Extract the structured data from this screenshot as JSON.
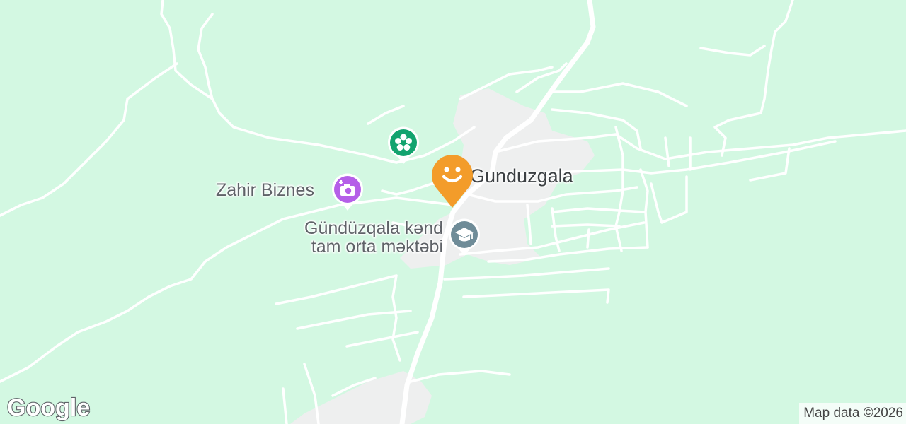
{
  "map": {
    "colors": {
      "land": "#d3f8e2",
      "road": "#ffffff",
      "settlement": "#eeefef"
    },
    "place_name": "Gunduzgala",
    "pois": [
      {
        "name": "Zahir Biznes",
        "icon": "camera-plus-icon",
        "color": "#b55fe8"
      },
      {
        "name_line1": "Gündüzqala kənd",
        "name_line2": "tam orta məktəbi",
        "icon": "graduation-cap-icon",
        "color": "#6f8c98"
      },
      {
        "name": "",
        "icon": "flower-icon",
        "color": "#12a36e"
      }
    ],
    "current_location": {
      "icon": "smiley-face-pin-icon",
      "color": "#f39c2a"
    }
  },
  "footer": {
    "logo_text": "Google",
    "attribution": "Map data ©2026"
  }
}
